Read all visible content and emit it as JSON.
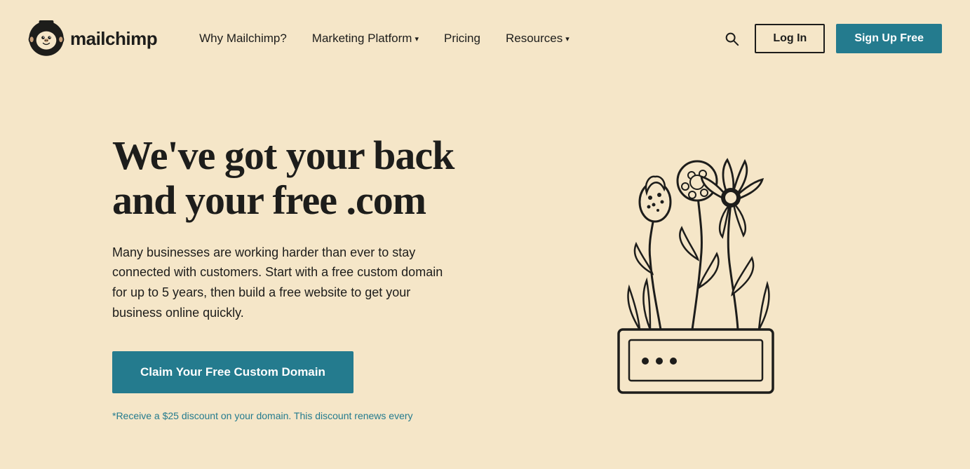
{
  "header": {
    "logo_text": "mailchimp",
    "nav": {
      "item1": "Why Mailchimp?",
      "item2": "Marketing Platform",
      "item3": "Pricing",
      "item4": "Resources"
    },
    "login_label": "Log In",
    "signup_label": "Sign Up Free"
  },
  "hero": {
    "headline_line1": "We've got your back",
    "headline_line2": "and your free .com",
    "subtext": "Many businesses are working harder than ever to stay connected with customers. Start with a free custom domain for up to 5 years, then build a free website to get your business online quickly.",
    "cta_label": "Claim Your Free Custom Domain",
    "disclaimer": "*Receive a $25 discount on your domain. This discount renews every"
  },
  "colors": {
    "background": "#f5e6c8",
    "teal": "#247b8e",
    "dark": "#1d1d1b"
  }
}
